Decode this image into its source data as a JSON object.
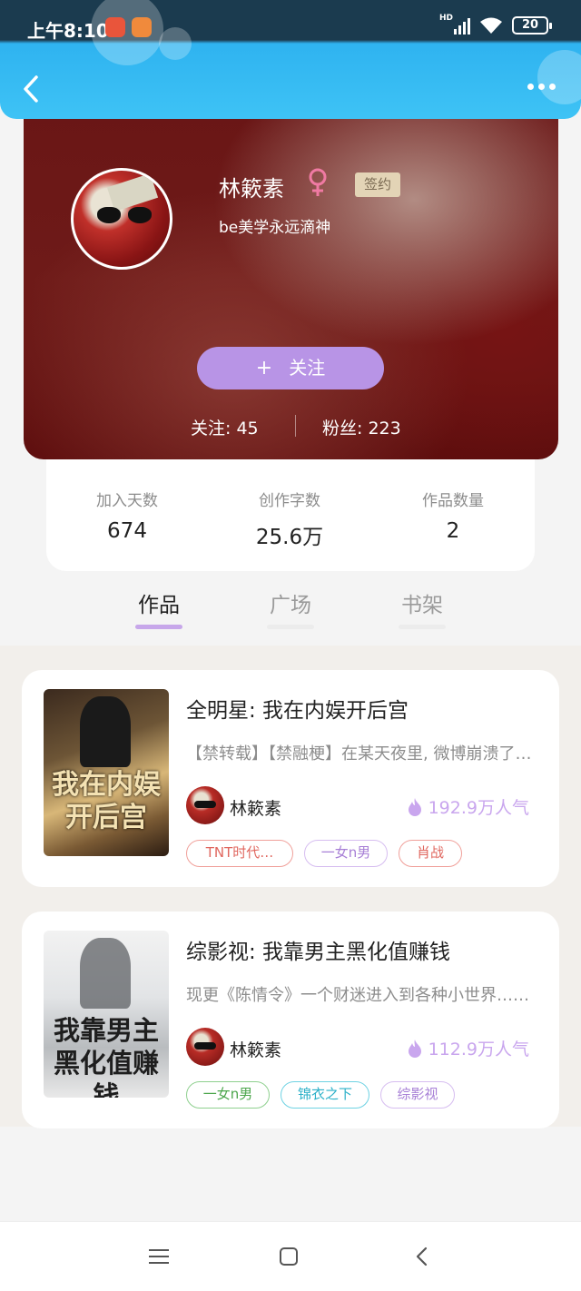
{
  "status_bar": {
    "time": "上午8:10",
    "battery": "20",
    "network": "HD"
  },
  "profile": {
    "name": "林簌素",
    "gender_icon": "female-icon",
    "sign_badge": "签约",
    "bio": "be美学永远滴神",
    "follow_button": "关注",
    "following_count": "关注: 45",
    "fans_count": "粉丝: 223"
  },
  "stats": [
    {
      "label": "加入天数",
      "value": "674"
    },
    {
      "label": "创作字数",
      "value": "25.6万"
    },
    {
      "label": "作品数量",
      "value": "2"
    }
  ],
  "tabs": [
    {
      "label": "作品",
      "active": true
    },
    {
      "label": "广场",
      "active": false
    },
    {
      "label": "书架",
      "active": false
    }
  ],
  "books": [
    {
      "title": "全明星: 我在内娱开后宫",
      "cover_text": "我在内娱开后宫",
      "description": "【禁转载】【禁融梗】在某天夜里, 微博崩溃了……",
      "author": "林簌素",
      "popularity": "192.9万人气",
      "tags": [
        "TNT时代…",
        "一女n男",
        "肖战"
      ]
    },
    {
      "title": "综影视: 我靠男主黑化值赚钱",
      "cover_text": "我靠男主黑化值赚钱",
      "description": "现更《陈情令》一个财迷进入到各种小世界……",
      "author": "林簌素",
      "popularity": "112.9万人气",
      "tags": [
        "一女n男",
        "锦衣之下",
        "综影视"
      ]
    }
  ],
  "colors": {
    "header": "#3ec3f5",
    "accent_purple": "#b894e6",
    "profile_bg": "#6a1616"
  }
}
